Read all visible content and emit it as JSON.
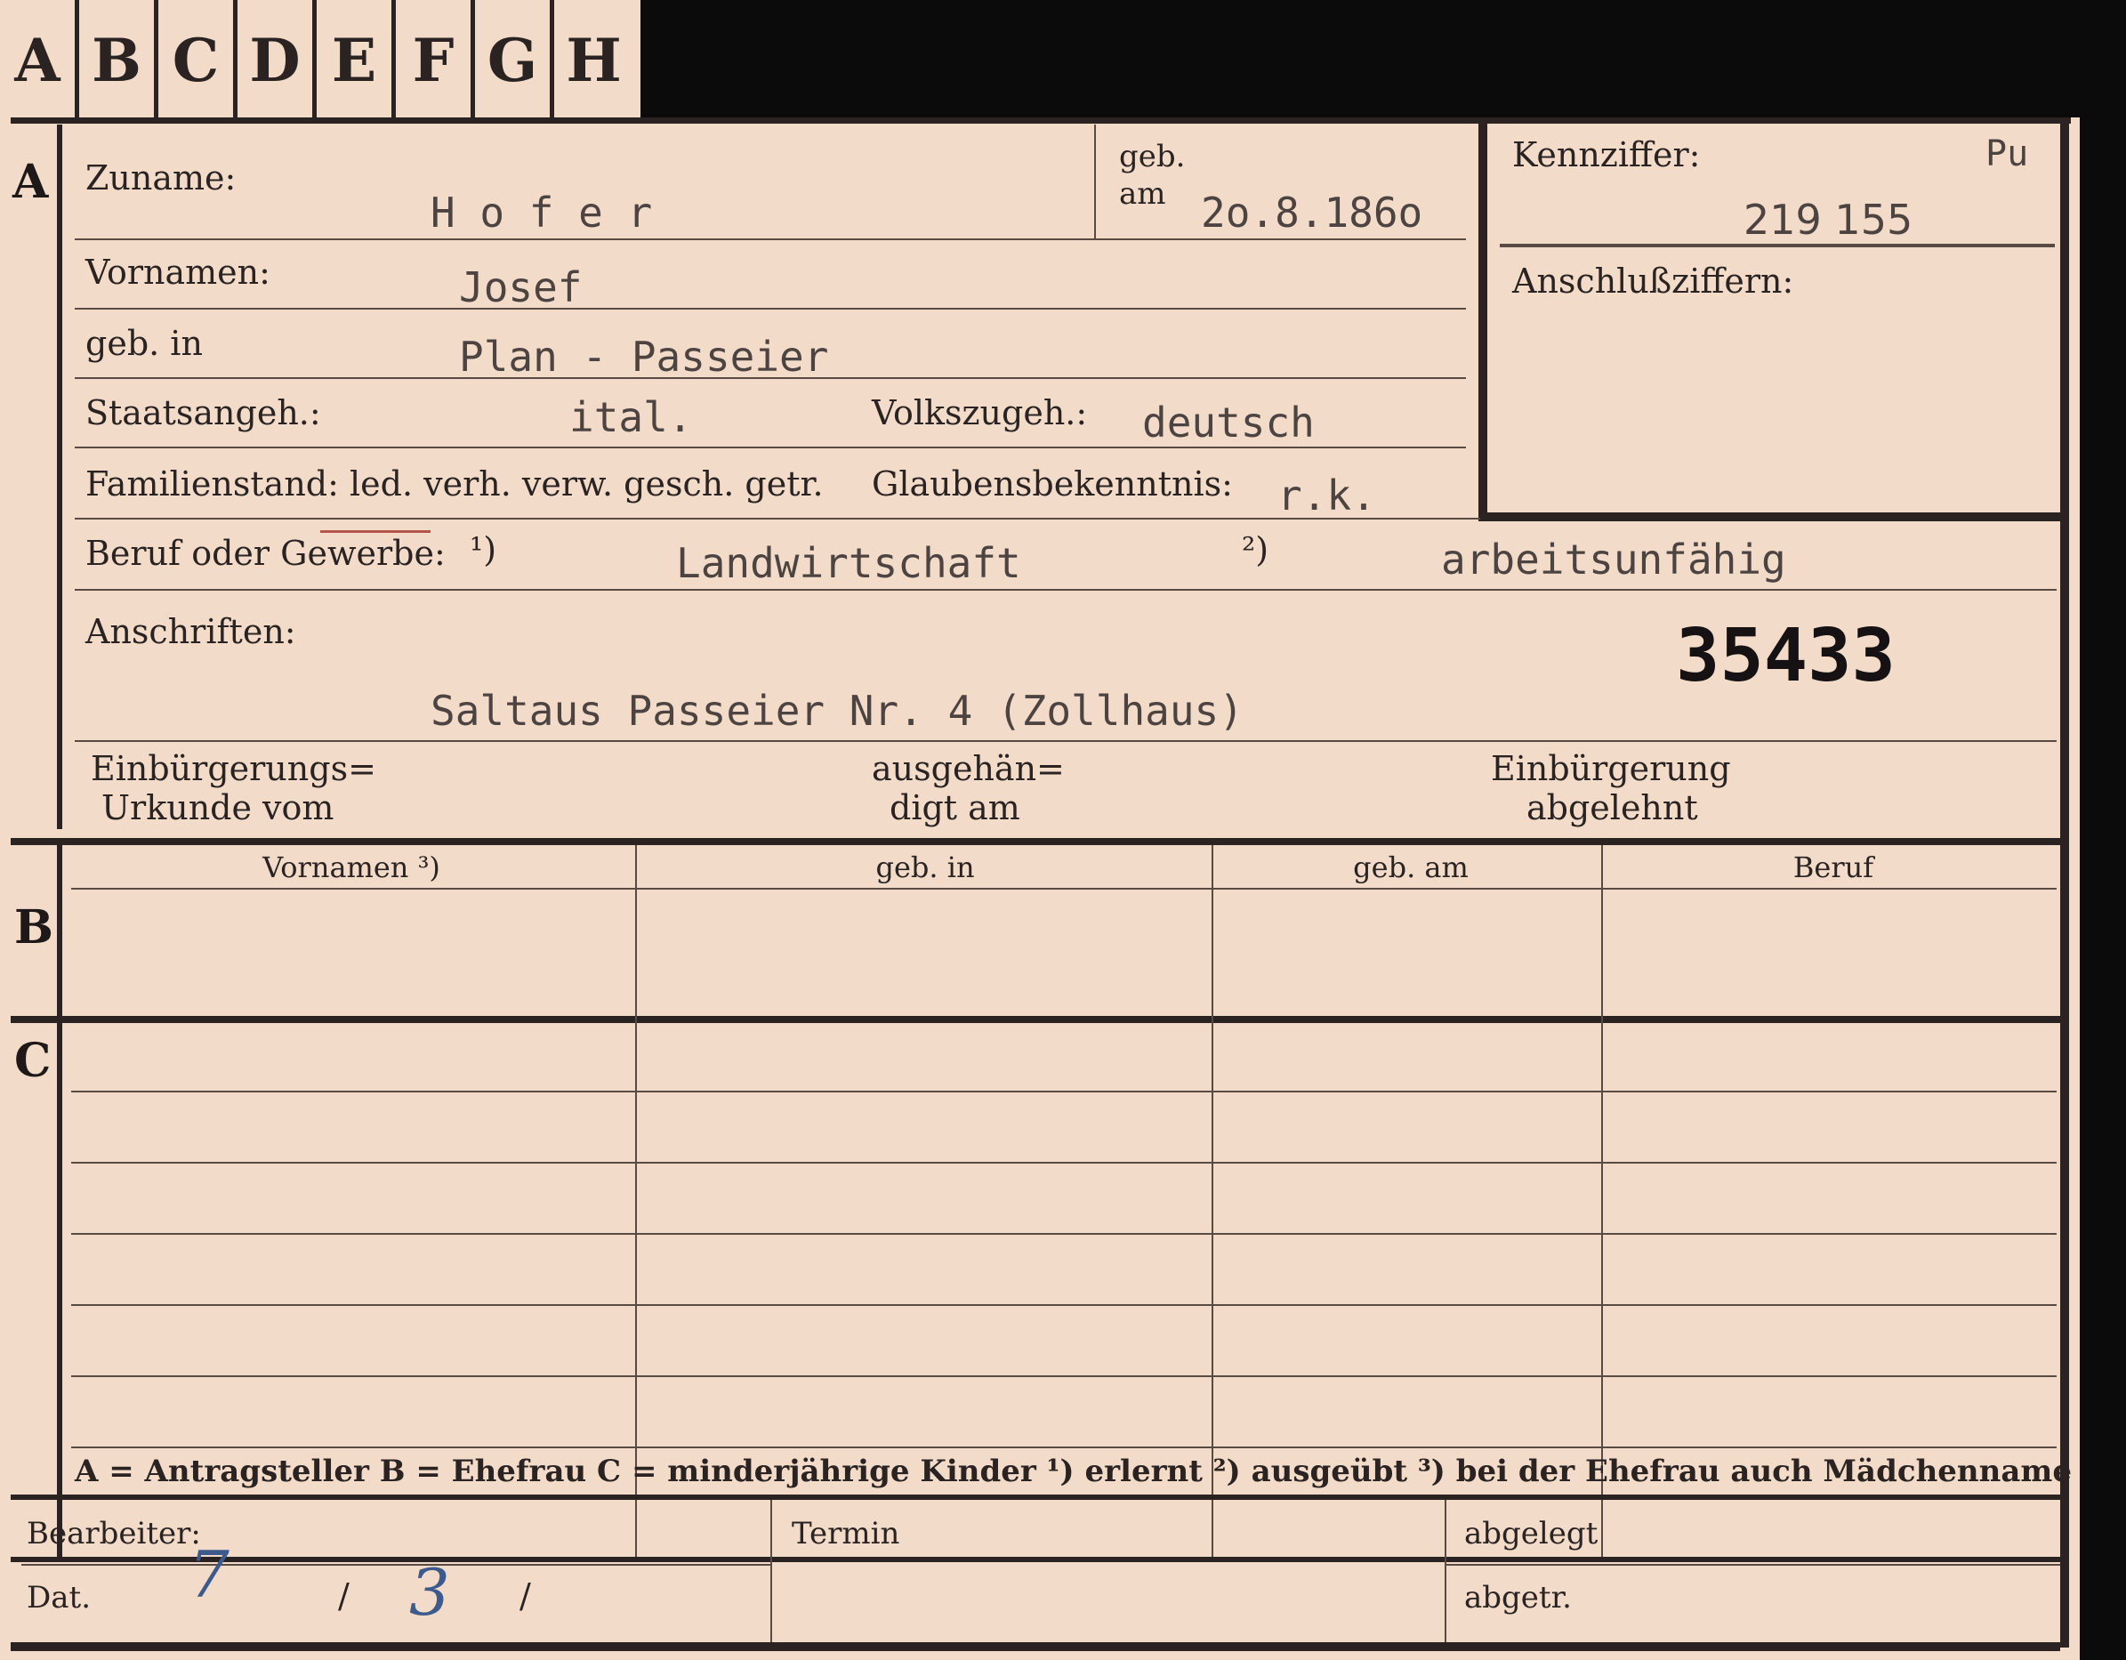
{
  "tabs": [
    "A",
    "B",
    "C",
    "D",
    "E",
    "F",
    "G",
    "H"
  ],
  "sections": {
    "a": "A",
    "b": "B",
    "c": "C"
  },
  "labels": {
    "zuname": "Zuname:",
    "geb": "geb.",
    "am": "am",
    "kennziffer": "Kennziffer:",
    "anschlussziffern": "Anschlußziffern:",
    "vornamen": "Vornamen:",
    "geb_in": "geb. in",
    "staatsangeh": "Staatsangeh.:",
    "volkszugeh": "Volkszugeh.:",
    "familienstand": "Familienstand: led. verh. verw. gesch. getr.",
    "glaubensbekenntnis": "Glaubensbekenntnis:",
    "beruf": "Beruf oder Gewerbe:",
    "note1": "¹)",
    "note2": "²)",
    "anschriften": "Anschriften:",
    "einb_urkunde_1": "Einbürgerungs=",
    "einb_urkunde_2": "Urkunde vom",
    "ausgehaen_1": "ausgehän=",
    "ausgehaen_2": "digt am",
    "einb_abgelehnt_1": "Einbürgerung",
    "einb_abgelehnt_2": "abgelehnt"
  },
  "values": {
    "zuname": "H o f e r",
    "geb_am": "2o.8.186o",
    "kennziffer_prefix": "Pu",
    "kennziffer": "219 155",
    "vornamen": "Josef",
    "geb_in": "Plan - Passeier",
    "staatsangeh": "ital.",
    "volkszugeh": "deutsch",
    "glaubensbekenntnis": "r.k.",
    "beruf_erlernt": "Landwirtschaft",
    "beruf_ausgeuebt": "arbeitsunfähig",
    "anschrift": "Saltaus Passeier  Nr. 4 (Zollhaus)",
    "stamp_number": "35433"
  },
  "table": {
    "headers": [
      "Vornamen ³)",
      "geb. in",
      "geb. am",
      "Beruf"
    ]
  },
  "footer": {
    "legend": "A = Antragsteller   B = Ehefrau   C = minderjährige Kinder   ¹) erlernt   ²) ausgeübt   ³) bei der Ehefrau auch Mädchenname",
    "bearbeiter": "Bearbeiter:",
    "dat": "Dat.",
    "termin": "Termin",
    "abgelegt": "abgelegt",
    "abgetr": "abgetr.",
    "date_day": "7",
    "date_month": "3",
    "slash": "/"
  }
}
